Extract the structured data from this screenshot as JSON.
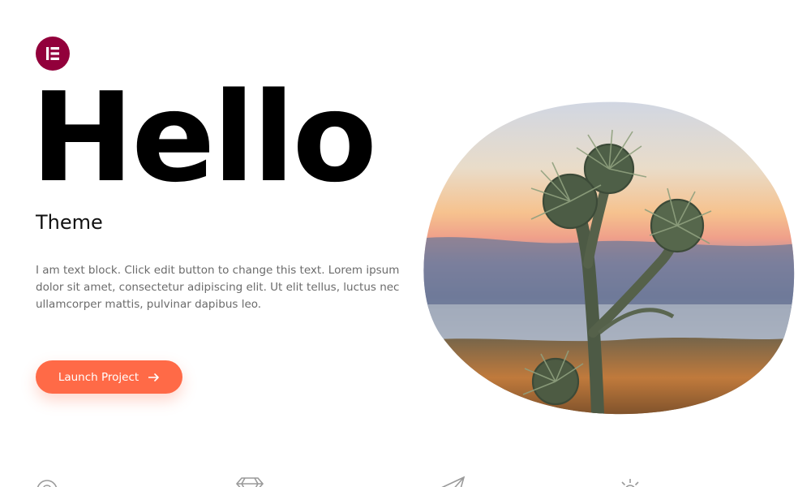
{
  "brand": {
    "logo_letter": "E",
    "logo_color": "#92003b"
  },
  "hero": {
    "title": "Hello",
    "subtitle": "Theme",
    "body": "I am text block. Click edit button to change this text. Lorem ipsum dolor sit amet, consectetur adipiscing elit. Ut elit tellus, luctus nec ullamcorper mattis, pulvinar dapibus leo.",
    "cta_label": "Launch Project",
    "cta_color": "#ff6a47"
  },
  "image": {
    "subject": "cactus-thistle-plant-at-sunset"
  },
  "features": {
    "icons": [
      "question-circle-icon",
      "diamond-icon",
      "paper-plane-icon",
      "sun-icon"
    ]
  }
}
